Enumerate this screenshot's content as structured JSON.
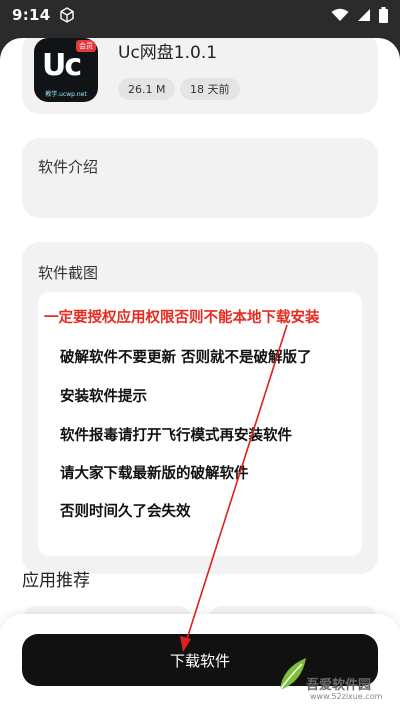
{
  "status_bar": {
    "time": "9:14",
    "icons": [
      "cube-icon",
      "wifi-icon",
      "signal-icon",
      "battery-icon"
    ]
  },
  "app": {
    "name": "Uc网盘1.0.1",
    "size": "26.1 M",
    "updated": "18 天前",
    "icon": {
      "text": "Uc",
      "tag": "会员",
      "site": "教学.ucwp.net"
    }
  },
  "intro": {
    "title": "软件介绍"
  },
  "screenshots": {
    "title": "软件截图",
    "lines": [
      "一定要授权应用权限否则不能本地下载安装",
      "破解软件不要更新 否则就不是破解版了",
      "安装软件提示",
      "软件报毒请打开飞行模式再安装软件",
      "请大家下载最新版的破解软件",
      "否则时间久了会失效"
    ]
  },
  "recommend": {
    "title": "应用推荐"
  },
  "download": {
    "label": "下载软件"
  },
  "watermark": {
    "name": "吾爱软件园",
    "site": "www.52zixue.com"
  },
  "colors": {
    "accent_red": "#e82a1f",
    "button_bg": "#111111",
    "card_bg": "#f2f2f2",
    "arrow": "#e02020"
  }
}
